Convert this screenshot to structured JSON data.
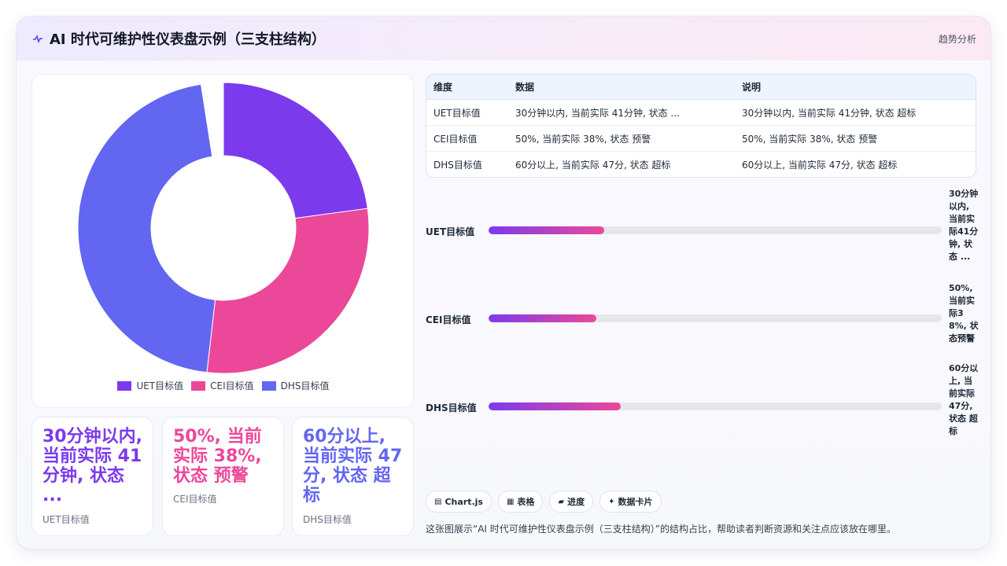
{
  "header": {
    "title": "AI 时代可维护性仪表盘示例（三支柱结构）",
    "trend_label": "趋势分析",
    "icon": "pulse-icon"
  },
  "colors": {
    "uet": "#7c3aed",
    "cei": "#ec4899",
    "dhs": "#6366f1"
  },
  "chart_data": {
    "type": "pie",
    "variant": "doughnut",
    "categories": [
      "UET目标值",
      "CEI目标值",
      "DHS目标值"
    ],
    "values": [
      30,
      38,
      60
    ],
    "colors": [
      "#7c3aed",
      "#ec4899",
      "#6366f1"
    ],
    "legend_position": "bottom"
  },
  "legend": [
    {
      "label": "UET目标值"
    },
    {
      "label": "CEI目标值"
    },
    {
      "label": "DHS目标值"
    }
  ],
  "stats": [
    {
      "value": "30分钟以内, 当前实际 41分钟, 状态 ...",
      "label": "UET目标值"
    },
    {
      "value": "50%, 当前实际 38%, 状态 预警",
      "label": "CEI目标值"
    },
    {
      "value": "60分以上, 当前实际 47分, 状态 超标",
      "label": "DHS目标值"
    }
  ],
  "table": {
    "headers": [
      "维度",
      "数据",
      "说明"
    ],
    "rows": [
      [
        "UET目标值",
        "30分钟以内, 当前实际 41分钟, 状态 ...",
        "30分钟以内, 当前实际 41分钟, 状态 超标"
      ],
      [
        "CEI目标值",
        "50%, 当前实际 38%, 状态 预警",
        "50%, 当前实际 38%, 状态 预警"
      ],
      [
        "DHS目标值",
        "60分以上, 当前实际 47分, 状态 超标",
        "60分以上, 当前实际 47分, 状态 超标"
      ]
    ]
  },
  "progress": [
    {
      "label": "UET目标值",
      "fraction": 0.255,
      "note": "30分钟以内, 当前实际41分钟, 状态 ..."
    },
    {
      "label": "CEI目标值",
      "fraction": 0.237,
      "note": "50%, 当前实际38%, 状态预警"
    },
    {
      "label": "DHS目标值",
      "fraction": 0.292,
      "note": "60分以上, 当前实际 47分, 状态 超标"
    }
  ],
  "chips": [
    {
      "icon": "chart-icon",
      "glyph": "▤",
      "label": "Chart.js"
    },
    {
      "icon": "table-icon",
      "glyph": "▦",
      "label": "表格"
    },
    {
      "icon": "progress-icon",
      "glyph": "▰",
      "label": "进度"
    },
    {
      "icon": "sparkle-icon",
      "glyph": "✦",
      "label": "数据卡片"
    }
  ],
  "footer": {
    "text": "这张图展示“AI 时代可维护性仪表盘示例（三支柱结构）”的结构占比，帮助读者判断资源和关注点应该放在哪里。"
  }
}
